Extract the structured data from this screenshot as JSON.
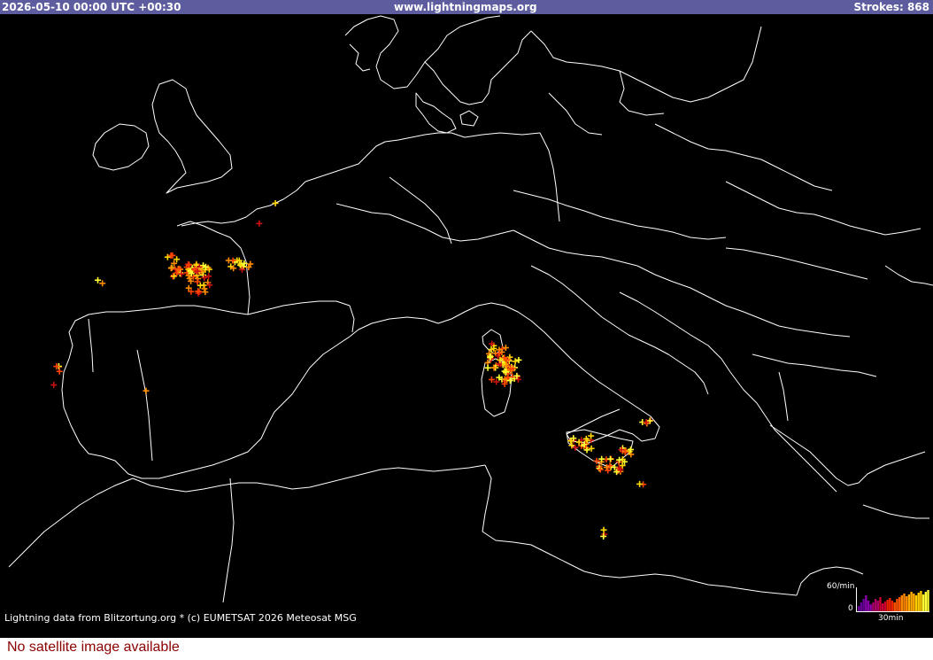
{
  "header": {
    "timestamp": "2026-05-10 00:00 UTC +00:30",
    "site": "www.lightningmaps.org",
    "strokes_label": "Strokes: 868"
  },
  "credit": {
    "text": "Lightning data from Blitzortung.org  *  (c) EUMETSAT 2026 Meteosat MSG"
  },
  "legend": {
    "max_label": "60/min",
    "zero_label": "0",
    "time_label": "30min"
  },
  "footer": {
    "message": "No satellite image available"
  },
  "colors": {
    "header_bg": "#5c5c9e",
    "map_bg": "#000000",
    "coastline": "#ffffff",
    "stroke_new": "#ffff33",
    "stroke_mid": "#ff8c00",
    "stroke_old": "#cc1111",
    "footer_text": "#8b0000"
  }
}
